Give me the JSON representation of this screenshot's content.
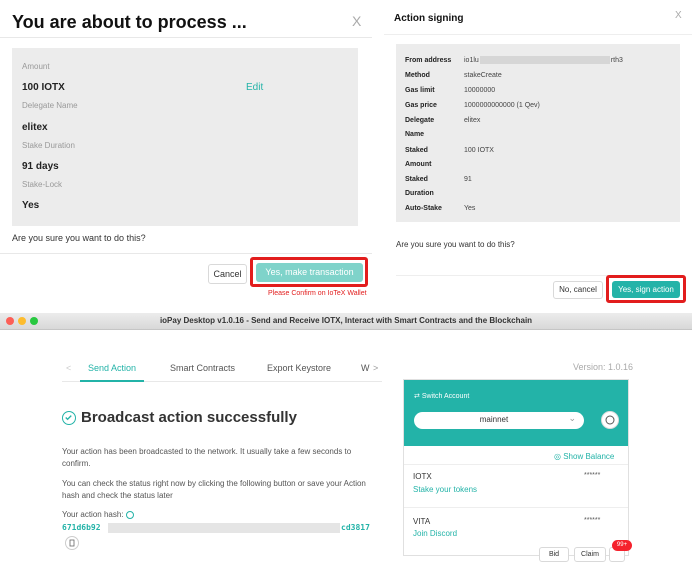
{
  "left_modal": {
    "title": "You are about to process ...",
    "close": "X",
    "fields": [
      {
        "label": "Amount",
        "value": "100 IOTX"
      },
      {
        "label": "Delegate Name",
        "value": "elitex"
      },
      {
        "label": "Stake Duration",
        "value": "91 days"
      },
      {
        "label": "Stake-Lock",
        "value": "Yes"
      }
    ],
    "edit": "Edit",
    "question": "Are you sure you want to do this?",
    "cancel": "Cancel",
    "confirm": "Yes, make transaction",
    "confirm_note": "Please Confirm on IoTeX Wallet"
  },
  "right_modal": {
    "title": "Action signing",
    "close": "X",
    "rows": [
      {
        "key": "From address",
        "value_prefix": "io1lu",
        "value_suffix": "rth3"
      },
      {
        "key": "Method",
        "value": "stakeCreate"
      },
      {
        "key": "Gas limit",
        "value": "10000000"
      },
      {
        "key": "Gas price",
        "value": "1000000000000 (1 Qev)"
      },
      {
        "key": "Delegate Name",
        "value": "elitex"
      },
      {
        "key": "Staked Amount",
        "value": "100 IOTX"
      },
      {
        "key": "Staked Duration",
        "value": "91"
      },
      {
        "key": "Auto-Stake",
        "value": "Yes"
      }
    ],
    "question": "Are you sure you want to do this?",
    "cancel": "No, cancel",
    "confirm": "Yes, sign action"
  },
  "window": {
    "title": "ioPay Desktop v1.0.16 - Send and Receive IOTX, Interact with Smart Contracts and the Blockchain"
  },
  "app": {
    "tabs": [
      "Send Action",
      "Smart Contracts",
      "Export Keystore",
      "W"
    ],
    "tab_prev": "<",
    "tab_next": ">",
    "success_title": "Broadcast action successfully",
    "para1": "Your action has been broadcasted to the network. It usually take a few seconds to confirm.",
    "para2": "You can check the status right now by clicking the following button or save your Action hash and check the status later",
    "hash_label": "Your action hash:",
    "hash_prefix": "671d6b92",
    "hash_suffix": "cd3817",
    "version": "Version: 1.0.16"
  },
  "wallet": {
    "switch_account": "Switch Account",
    "network": "mainnet",
    "show_balance": "Show Balance",
    "tokens": [
      {
        "name": "IOTX",
        "link": "Stake your tokens",
        "balance": "******"
      },
      {
        "name": "VITA",
        "link": "Join Discord",
        "balance": "******"
      }
    ],
    "bid": "Bid",
    "claim": "Claim",
    "badge": "99+"
  }
}
